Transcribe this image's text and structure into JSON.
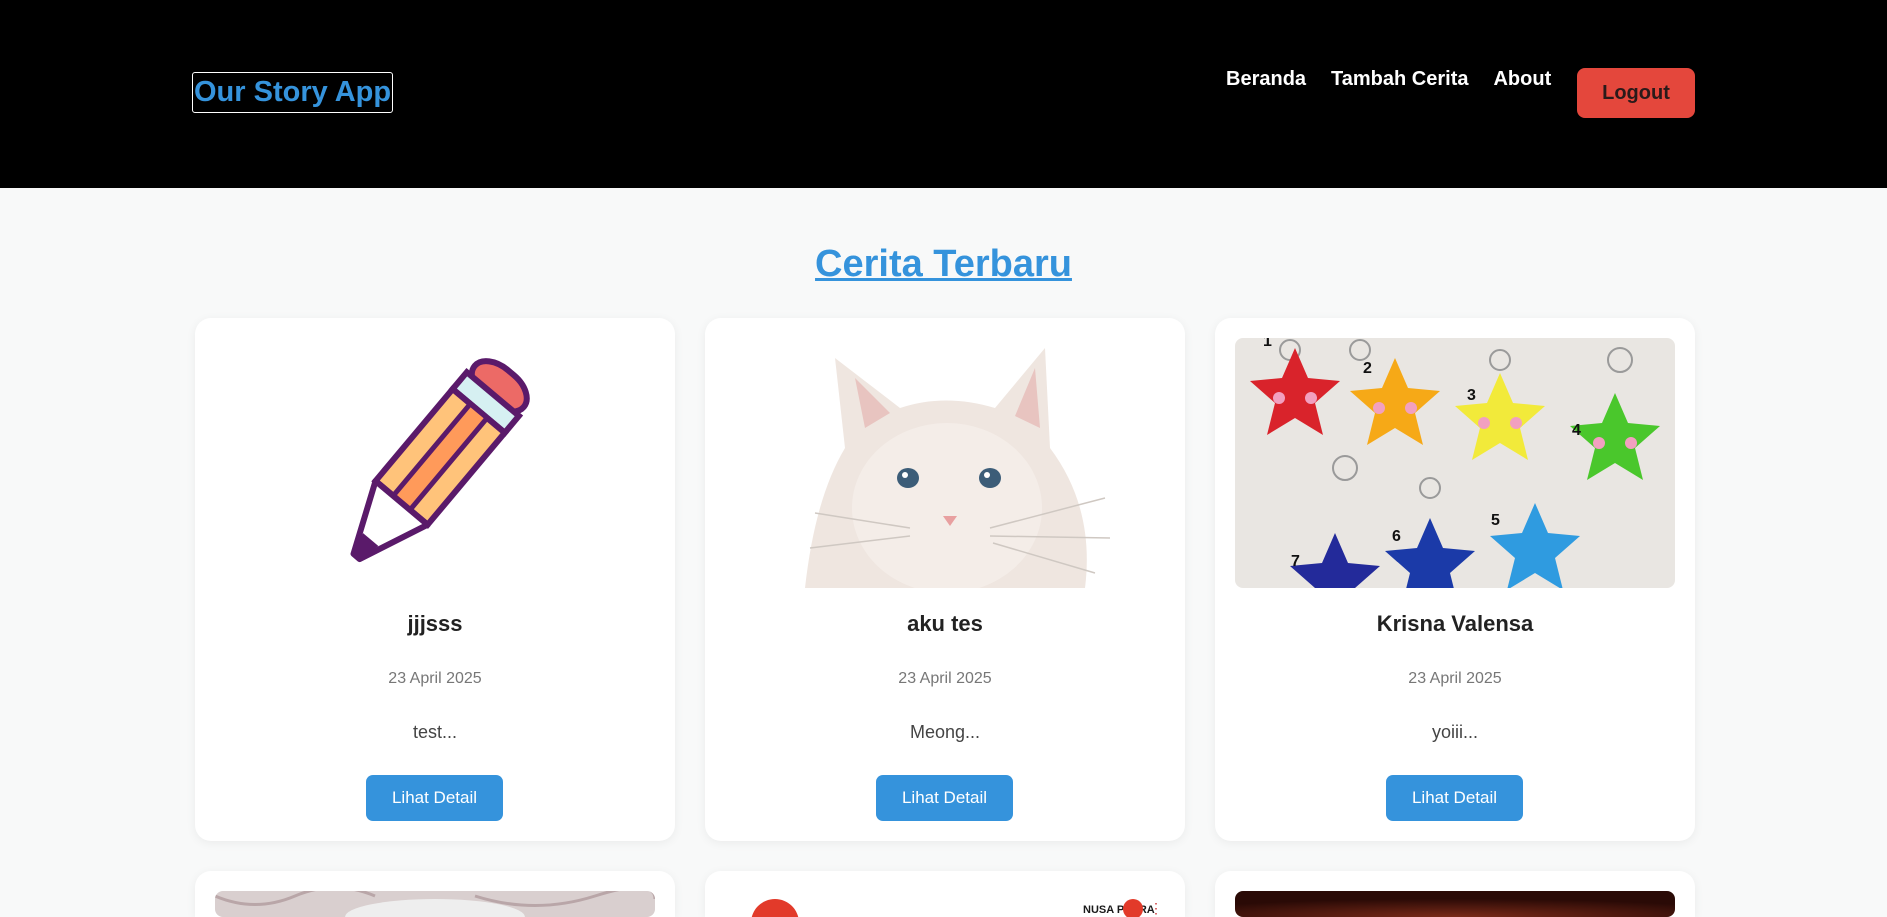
{
  "header": {
    "brand": "Our Story App",
    "nav": [
      "Beranda",
      "Tambah Cerita",
      "About"
    ],
    "logout_label": "Logout"
  },
  "main": {
    "title": "Cerita Terbaru",
    "stories": [
      {
        "name": "jjjsss",
        "date": "23 April 2025",
        "excerpt": "test...",
        "button": "Lihat Detail",
        "image": "pencil-illustration"
      },
      {
        "name": "aku tes",
        "date": "23 April 2025",
        "excerpt": "Meong...",
        "button": "Lihat Detail",
        "image": "white-kitten-photo"
      },
      {
        "name": "Krisna Valensa",
        "date": "23 April 2025",
        "excerpt": "yoiii...",
        "button": "Lihat Detail",
        "image": "felt-star-keychains-photo"
      }
    ],
    "partial_cards": [
      {
        "image": "lace-photo"
      },
      {
        "image": "nusa-putra-poster",
        "logo_text": "NUSA PUTRA"
      },
      {
        "image": "dark-red-photo"
      }
    ]
  },
  "colors": {
    "accent": "#3593dc",
    "logout": "#e4473c",
    "header_bg": "#000000",
    "page_bg": "#f8f9f9"
  }
}
